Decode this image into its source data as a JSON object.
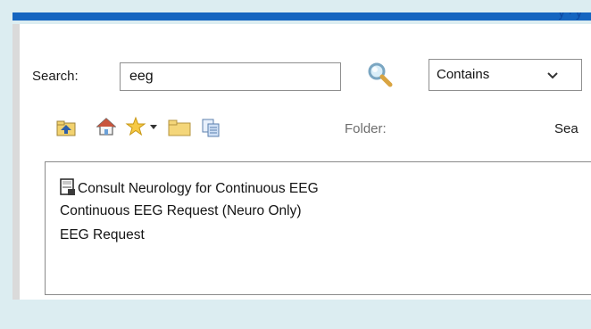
{
  "window": {
    "title_fragment": "y  ·  y"
  },
  "search": {
    "label": "Search:",
    "value": "eeg",
    "mode": "Contains"
  },
  "toolbar": {
    "folder_label": "Folder:",
    "search_truncated": "Sea"
  },
  "results": [
    {
      "label": "Consult Neurology for Continuous EEG",
      "icon": "document-icon"
    },
    {
      "label": "Continuous EEG Request (Neuro Only)"
    },
    {
      "label": "EEG Request"
    }
  ],
  "colors": {
    "titlebar": "#1565c0",
    "background": "#dcedf1",
    "folder_label": "#6d6d6d"
  }
}
